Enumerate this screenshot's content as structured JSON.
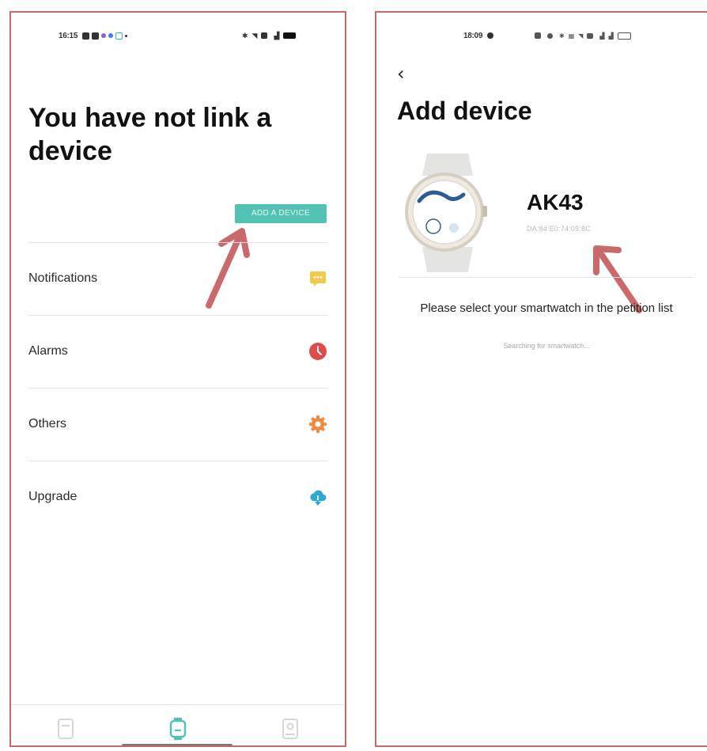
{
  "left_screen": {
    "status_bar": {
      "time": "16:15"
    },
    "title": "You have not link a device",
    "add_device_label": "ADD A DEVICE",
    "menu": [
      {
        "label": "Notifications",
        "icon": "message-icon",
        "color": "#f2c94c"
      },
      {
        "label": "Alarms",
        "icon": "clock-icon",
        "color": "#e04c4c"
      },
      {
        "label": "Others",
        "icon": "gear-icon",
        "color": "#f08a3c"
      },
      {
        "label": "Upgrade",
        "icon": "cloud-download-icon",
        "color": "#2fa9cf"
      }
    ],
    "bottom_nav": [
      {
        "icon": "activity-tab-icon",
        "active": false
      },
      {
        "icon": "watch-tab-icon",
        "active": true
      },
      {
        "icon": "profile-tab-icon",
        "active": false
      }
    ]
  },
  "right_screen": {
    "status_bar": {
      "time": "18:09"
    },
    "back_icon": "‹",
    "title": "Add device",
    "device": {
      "name": "AK43",
      "mac": "DA:84:E0:74:09:8C",
      "image": "smartwatch-image"
    },
    "prompt": "Please select your smartwatch in the petition list",
    "status": "Searching for smartwatch..."
  },
  "colors": {
    "accent": "#52c2b4",
    "annotation": "#c9696b",
    "frame": "#c9696b"
  }
}
